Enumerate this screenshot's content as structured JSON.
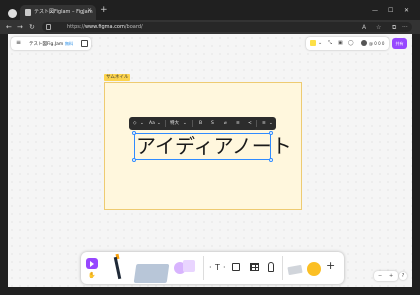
{
  "browser": {
    "tab_title": "テスト図Figlam – FigJam",
    "tab_close": "×",
    "new_tab": "+",
    "url_prefix": "https://",
    "url_host": "www.figma.com",
    "url_path": "/board/",
    "win_min": "—",
    "win_max": "☐",
    "win_close": "✕",
    "back": "←",
    "forward": "→",
    "reload": "↻",
    "more": "···"
  },
  "file": {
    "menu_glyph": "≡",
    "name": "テスト図Fig.Jam",
    "badge": "無料"
  },
  "header": {
    "zoom_text": "@ 0 0 0",
    "share_label": "共有"
  },
  "canvas": {
    "frame_label": "サムネイル",
    "selected_text": "アイディアノート",
    "text_toolbar": {
      "font": "Aa",
      "font_size": "特大",
      "bold": "B",
      "strike": "S",
      "link": "⌀",
      "list": "≡",
      "more": "≡"
    }
  },
  "bottom_toolbar": {
    "hand": "✋",
    "text_tool": "T",
    "plus": "+"
  },
  "zoom_control": {
    "minus": "−",
    "plus": "+"
  },
  "help_label": "?"
}
